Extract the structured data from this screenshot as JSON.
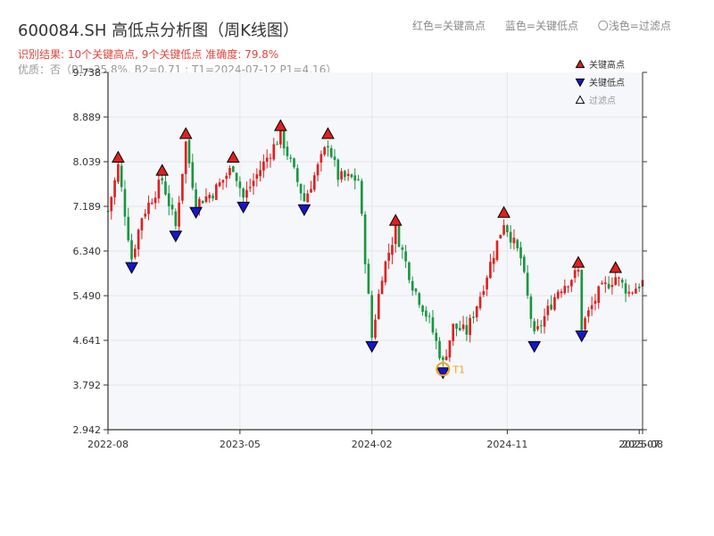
{
  "header": {
    "title": "600084.SH 高低点分析图（周K线图）",
    "subtitle": "识别结果: 10个关键高点, 9个关键低点   准确度: 79.8%",
    "stats": "优质：否（P1=35.8%, B2=0.71 ; T1=2024-07-12 P1=4.16）",
    "legend_high": "红色=关键高点",
    "legend_low": "蓝色=关键低点",
    "legend_filtered": "〇浅色=过滤点"
  },
  "chart_data": {
    "type": "candlestick",
    "ylim": [
      2.942,
      9.738
    ],
    "y_ticks": [
      "9.738",
      "8.889",
      "8.039",
      "7.189",
      "6.340",
      "5.490",
      "4.641",
      "3.792",
      "2.942"
    ],
    "x_ticks": [
      "2022-08",
      "2023-05",
      "2024-02",
      "2024-11",
      "2025-07",
      "2025-08"
    ],
    "x_range_weeks": [
      0,
      158
    ],
    "x_tick_weeks": [
      0,
      39,
      78,
      118,
      157,
      158
    ],
    "grid": true,
    "legend_position": "top-right",
    "legend": [
      {
        "label": "关键高点",
        "color": "#e02020",
        "shape": "triangle-up"
      },
      {
        "label": "关键低点",
        "color": "#1515cc",
        "shape": "triangle-down"
      },
      {
        "label": "过滤点",
        "color": "#ffffff",
        "shape": "triangle-up"
      }
    ],
    "colors": {
      "up": "#e02020",
      "down": "#1a9641",
      "high": "#e02020",
      "low": "#1515cc",
      "t1": "#f0a020"
    },
    "anchors": [
      [
        0,
        7.1
      ],
      [
        3,
        7.95
      ],
      [
        7,
        6.2
      ],
      [
        10,
        7.0
      ],
      [
        16,
        7.7
      ],
      [
        20,
        6.8
      ],
      [
        23,
        8.4
      ],
      [
        26,
        7.25
      ],
      [
        31,
        7.45
      ],
      [
        37,
        7.95
      ],
      [
        40,
        7.35
      ],
      [
        51,
        8.55
      ],
      [
        58,
        7.3
      ],
      [
        65,
        8.4
      ],
      [
        68,
        7.75
      ],
      [
        74,
        7.7
      ],
      [
        78,
        4.7
      ],
      [
        81,
        5.9
      ],
      [
        85,
        6.75
      ],
      [
        90,
        5.7
      ],
      [
        95,
        5.0
      ],
      [
        99,
        4.2
      ],
      [
        102,
        4.9
      ],
      [
        106,
        4.8
      ],
      [
        110,
        5.5
      ],
      [
        117,
        6.9
      ],
      [
        122,
        6.2
      ],
      [
        126,
        4.7
      ],
      [
        133,
        5.6
      ],
      [
        139,
        5.95
      ],
      [
        140,
        4.9
      ],
      [
        145,
        5.55
      ],
      [
        150,
        5.85
      ],
      [
        154,
        5.55
      ],
      [
        158,
        5.75
      ]
    ],
    "key_highs": [
      {
        "week": 3,
        "price": 7.95
      },
      {
        "week": 16,
        "price": 7.7
      },
      {
        "week": 23,
        "price": 8.4
      },
      {
        "week": 37,
        "price": 7.95
      },
      {
        "week": 51,
        "price": 8.55
      },
      {
        "week": 65,
        "price": 8.4
      },
      {
        "week": 85,
        "price": 6.75
      },
      {
        "week": 117,
        "price": 6.9
      },
      {
        "week": 139,
        "price": 5.95
      },
      {
        "week": 150,
        "price": 5.85
      }
    ],
    "key_lows": [
      {
        "week": 7,
        "price": 6.2
      },
      {
        "week": 20,
        "price": 6.8
      },
      {
        "week": 26,
        "price": 7.25
      },
      {
        "week": 40,
        "price": 7.35
      },
      {
        "week": 58,
        "price": 7.3
      },
      {
        "week": 78,
        "price": 4.7
      },
      {
        "week": 99,
        "price": 4.2
      },
      {
        "week": 126,
        "price": 4.7
      },
      {
        "week": 140,
        "price": 4.9
      }
    ],
    "t1": {
      "week": 99,
      "price": 4.16,
      "label": "T1"
    }
  }
}
